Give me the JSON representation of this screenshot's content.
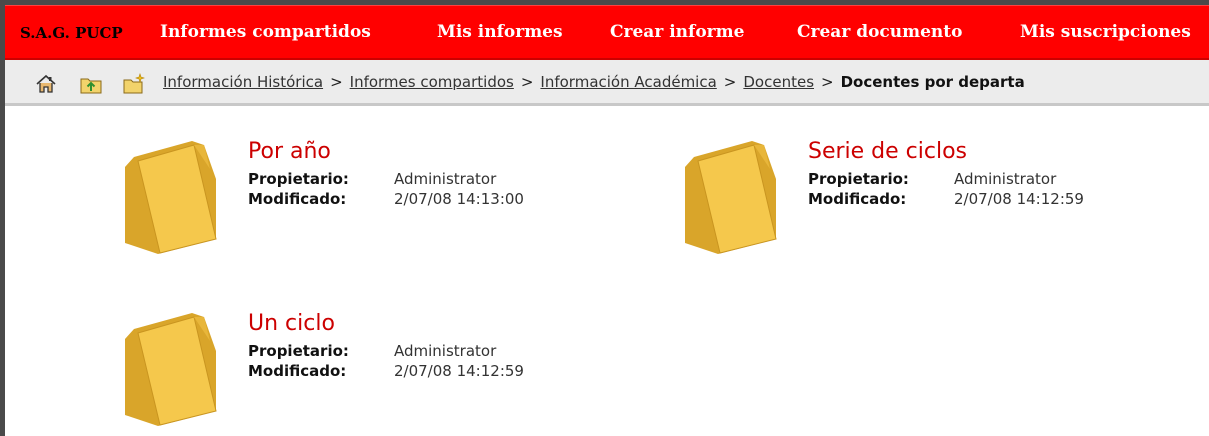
{
  "nav": {
    "brand": "S.A.G. PUCP",
    "items": [
      "Informes compartidos",
      "Mis informes",
      "Crear informe",
      "Crear documento",
      "Mis suscripciones"
    ]
  },
  "toolbar": {
    "icons": [
      "home-icon",
      "folder-up-icon",
      "new-folder-icon"
    ]
  },
  "breadcrumb": {
    "links": [
      "Información Histórica",
      "Informes compartidos",
      "Información Académica",
      "Docentes"
    ],
    "separator": ">",
    "current": "Docentes por departa"
  },
  "owner_label": "Propietario:",
  "modified_label": "Modificado:",
  "folders": [
    {
      "title": "Por año",
      "owner": "Administrator",
      "modified": "2/07/08 14:13:00"
    },
    {
      "title": "Serie de ciclos",
      "owner": "Administrator",
      "modified": "2/07/08 14:12:59"
    },
    {
      "title": "Un ciclo",
      "owner": "Administrator",
      "modified": "2/07/08 14:12:59"
    }
  ],
  "colors": {
    "nav_bg": "#ff0000",
    "title": "#cc0000",
    "folder": "#f5c84c"
  }
}
